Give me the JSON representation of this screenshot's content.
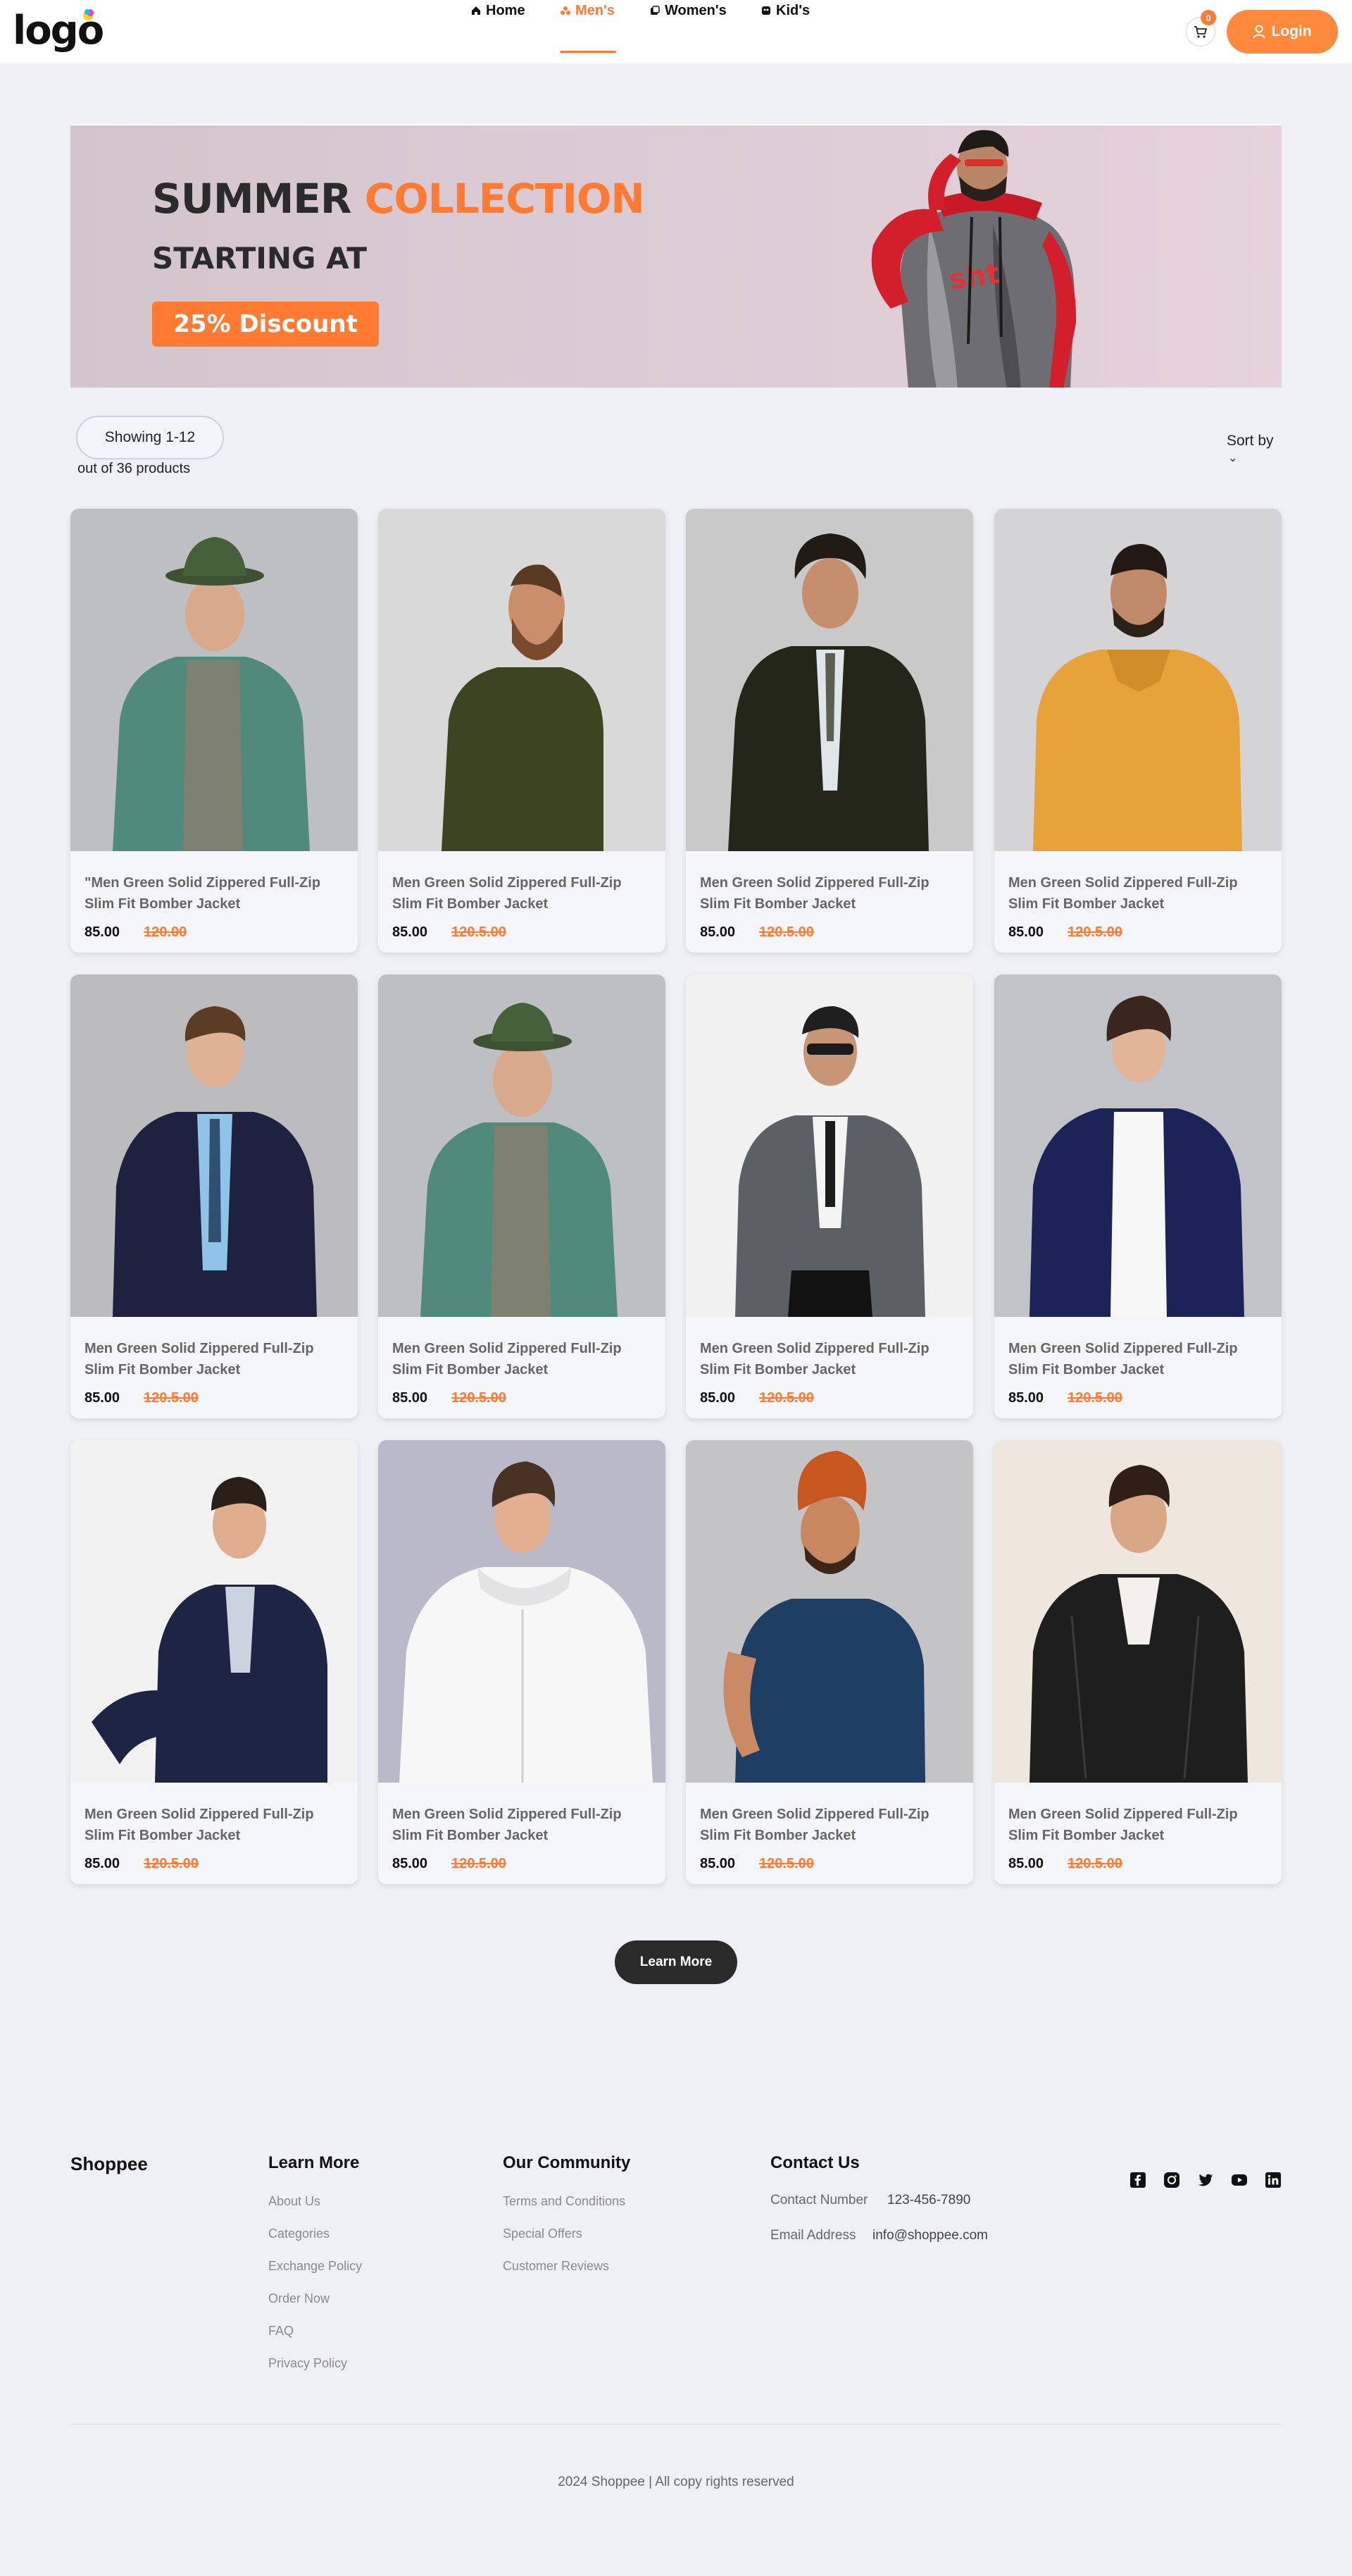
{
  "header": {
    "logo_text": "logo",
    "nav": [
      {
        "label": "Home",
        "icon": "home-icon"
      },
      {
        "label": "Men's",
        "icon": "men-icon",
        "active": true
      },
      {
        "label": "Women's",
        "icon": "women-icon"
      },
      {
        "label": "Kid's",
        "icon": "kids-icon"
      }
    ],
    "cart_count": "0",
    "login_label": "Login",
    "accent_color": "#ff7a33"
  },
  "banner": {
    "title_part1": "SUMMER",
    "title_part2": "COLLECTION",
    "subtitle": "STARTING AT",
    "badge": "25% Discount"
  },
  "listing": {
    "showing": "Showing 1-12",
    "total": "out of 36 products",
    "sort_label": "Sort by",
    "sort_chevron": "⌄"
  },
  "products": [
    {
      "title": "\"Men Green Solid Zippered Full-Zip Slim Fit Bomber Jacket",
      "price": "85.00",
      "old_price": "120.00"
    },
    {
      "title": "Men Green Solid Zippered Full-Zip Slim Fit Bomber Jacket",
      "price": "85.00",
      "old_price": "120.5.00"
    },
    {
      "title": "Men Green Solid Zippered Full-Zip Slim Fit Bomber Jacket",
      "price": "85.00",
      "old_price": "120.5.00"
    },
    {
      "title": "Men Green Solid Zippered Full-Zip Slim Fit Bomber Jacket",
      "price": "85.00",
      "old_price": "120.5.00"
    },
    {
      "title": "Men Green Solid Zippered Full-Zip Slim Fit Bomber Jacket",
      "price": "85.00",
      "old_price": "120.5.00"
    },
    {
      "title": "Men Green Solid Zippered Full-Zip Slim Fit Bomber Jacket",
      "price": "85.00",
      "old_price": "120.5.00"
    },
    {
      "title": "Men Green Solid Zippered Full-Zip Slim Fit Bomber Jacket",
      "price": "85.00",
      "old_price": "120.5.00"
    },
    {
      "title": "Men Green Solid Zippered Full-Zip Slim Fit Bomber Jacket",
      "price": "85.00",
      "old_price": "120.5.00"
    },
    {
      "title": "Men Green Solid Zippered Full-Zip Slim Fit Bomber Jacket",
      "price": "85.00",
      "old_price": "120.5.00"
    },
    {
      "title": "Men Green Solid Zippered Full-Zip Slim Fit Bomber Jacket",
      "price": "85.00",
      "old_price": "120.5.00"
    },
    {
      "title": "Men Green Solid Zippered Full-Zip Slim Fit Bomber Jacket",
      "price": "85.00",
      "old_price": "120.5.00"
    },
    {
      "title": "Men Green Solid Zippered Full-Zip Slim Fit Bomber Jacket",
      "price": "85.00",
      "old_price": "120.5.00"
    }
  ],
  "learn_more": "Learn More",
  "footer": {
    "brand": "Shoppee",
    "learn_more_title": "Learn More",
    "learn_more_links": [
      "About Us",
      "Categories",
      "Exchange Policy",
      "Order Now",
      "FAQ",
      "Privacy Policy"
    ],
    "community_title": "Our Community",
    "community_links": [
      "Terms and Conditions",
      "Special Offers",
      "Customer Reviews"
    ],
    "contact_title": "Contact Us",
    "contact_number_label": "Contact Number",
    "contact_number": "123-456-7890",
    "email_label": "Email Address",
    "email": "info@shoppee.com",
    "social_icons": [
      "facebook-icon",
      "instagram-icon",
      "twitter-icon",
      "youtube-icon",
      "linkedin-icon"
    ],
    "copyright": "2024 Shoppee | All copy rights reserved"
  }
}
